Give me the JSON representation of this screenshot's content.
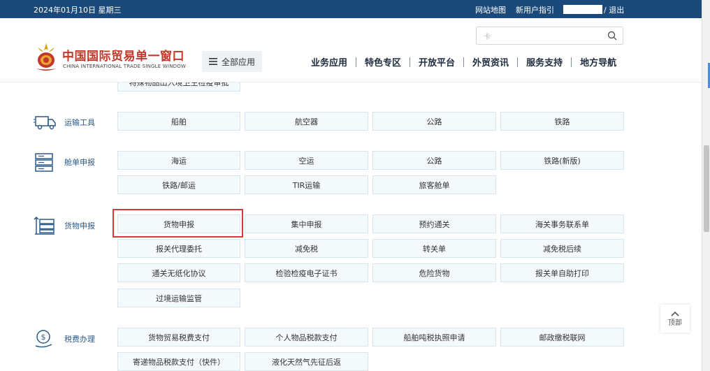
{
  "topbar": {
    "date": "2024年01月10日 星期三",
    "links": [
      "网站地图",
      "新用户指引"
    ],
    "logout": "/  退出"
  },
  "header": {
    "logo_cn": "中国国际贸易单一窗口",
    "logo_en": "CHINA INTERNATIONAL TRADE SINGLE WINDOW",
    "all_apps": "全部应用",
    "search_placeholder": "卡",
    "nav": [
      "业务应用",
      "特色专区",
      "开放平台",
      "外贸资讯",
      "服务支持",
      "地方导航"
    ]
  },
  "partial_top_button": "特殊物品出入境卫生检疫审批",
  "categories": {
    "transport": {
      "label": "运输工具",
      "items": [
        "船舶",
        "航空器",
        "公路",
        "铁路"
      ]
    },
    "manifest": {
      "label": "舱单申报",
      "items": [
        "海运",
        "空运",
        "公路",
        "铁路(新版)",
        "铁路/邮运",
        "TIR运输",
        "旅客舱单"
      ]
    },
    "cargo": {
      "label": "货物申报",
      "items": [
        "货物申报",
        "集中申报",
        "预约通关",
        "海关事务联系单",
        "报关代理委托",
        "减免税",
        "转关单",
        "减免税后续",
        "通关无纸化协议",
        "检验检疫电子证书",
        "危险货物",
        "报关单自助打印",
        "过境运输监管"
      ]
    },
    "tax": {
      "label": "税费办理",
      "items": [
        "货物贸易税费支付",
        "个人物品税款支付",
        "船舶吨税执照申请",
        "邮政缴税联网",
        "寄递物品税款支付（快件）",
        "液化天然气先征后返"
      ]
    }
  },
  "to_top": "顶部",
  "colors": {
    "topbar": "#1b4a7a",
    "highlight": "#d63b3b",
    "button_bg": "#f4f9fc"
  }
}
